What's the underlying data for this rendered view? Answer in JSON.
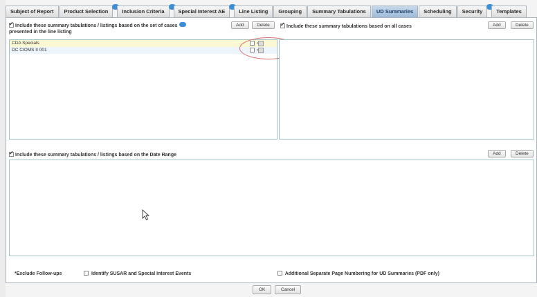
{
  "tabs": [
    {
      "label": "Subject of Report"
    },
    {
      "label": "Product Selection"
    },
    {
      "label": "Inclusion Criteria"
    },
    {
      "label": "Special Interest AE"
    },
    {
      "label": "Line Listing"
    },
    {
      "label": "Grouping"
    },
    {
      "label": "Summary Tabulations"
    },
    {
      "label": "UD Summaries"
    },
    {
      "label": "Scheduling"
    },
    {
      "label": "Security"
    },
    {
      "label": "Templates"
    }
  ],
  "active_tab": "UD Summaries",
  "cases_section": {
    "header_line1": "Include these summary tabulations / listings based on the set of cases",
    "header_line2": "presented in the line listing",
    "add_label": "Add",
    "delete_label": "Delete",
    "rows": [
      {
        "label": "CDA Specials"
      },
      {
        "label": "DC CIOMS II 001"
      }
    ]
  },
  "all_cases_section": {
    "header": "Include these summary tabulations based on all cases",
    "add_label": "Add",
    "delete_label": "Delete"
  },
  "date_range_section": {
    "header": "Include these summary tabulations / listings based on the Date Range",
    "add_label": "Add",
    "delete_label": "Delete"
  },
  "footer": {
    "exclude_label": "*Exclude Follow-ups",
    "identify_label": "Identify SUSAR and Special Interest Events",
    "numbering_label": "Additional Separate Page Numbering for UD Summaries (PDF only)"
  },
  "buttons": {
    "ok_label": "OK",
    "cancel_label": "Cancel"
  },
  "colors": {
    "active_tab": "#9ebad8",
    "listbox_border": "#9fc0c4",
    "selected_row": "#fbf8d4",
    "highlight_ellipse": "#d66b6b"
  }
}
